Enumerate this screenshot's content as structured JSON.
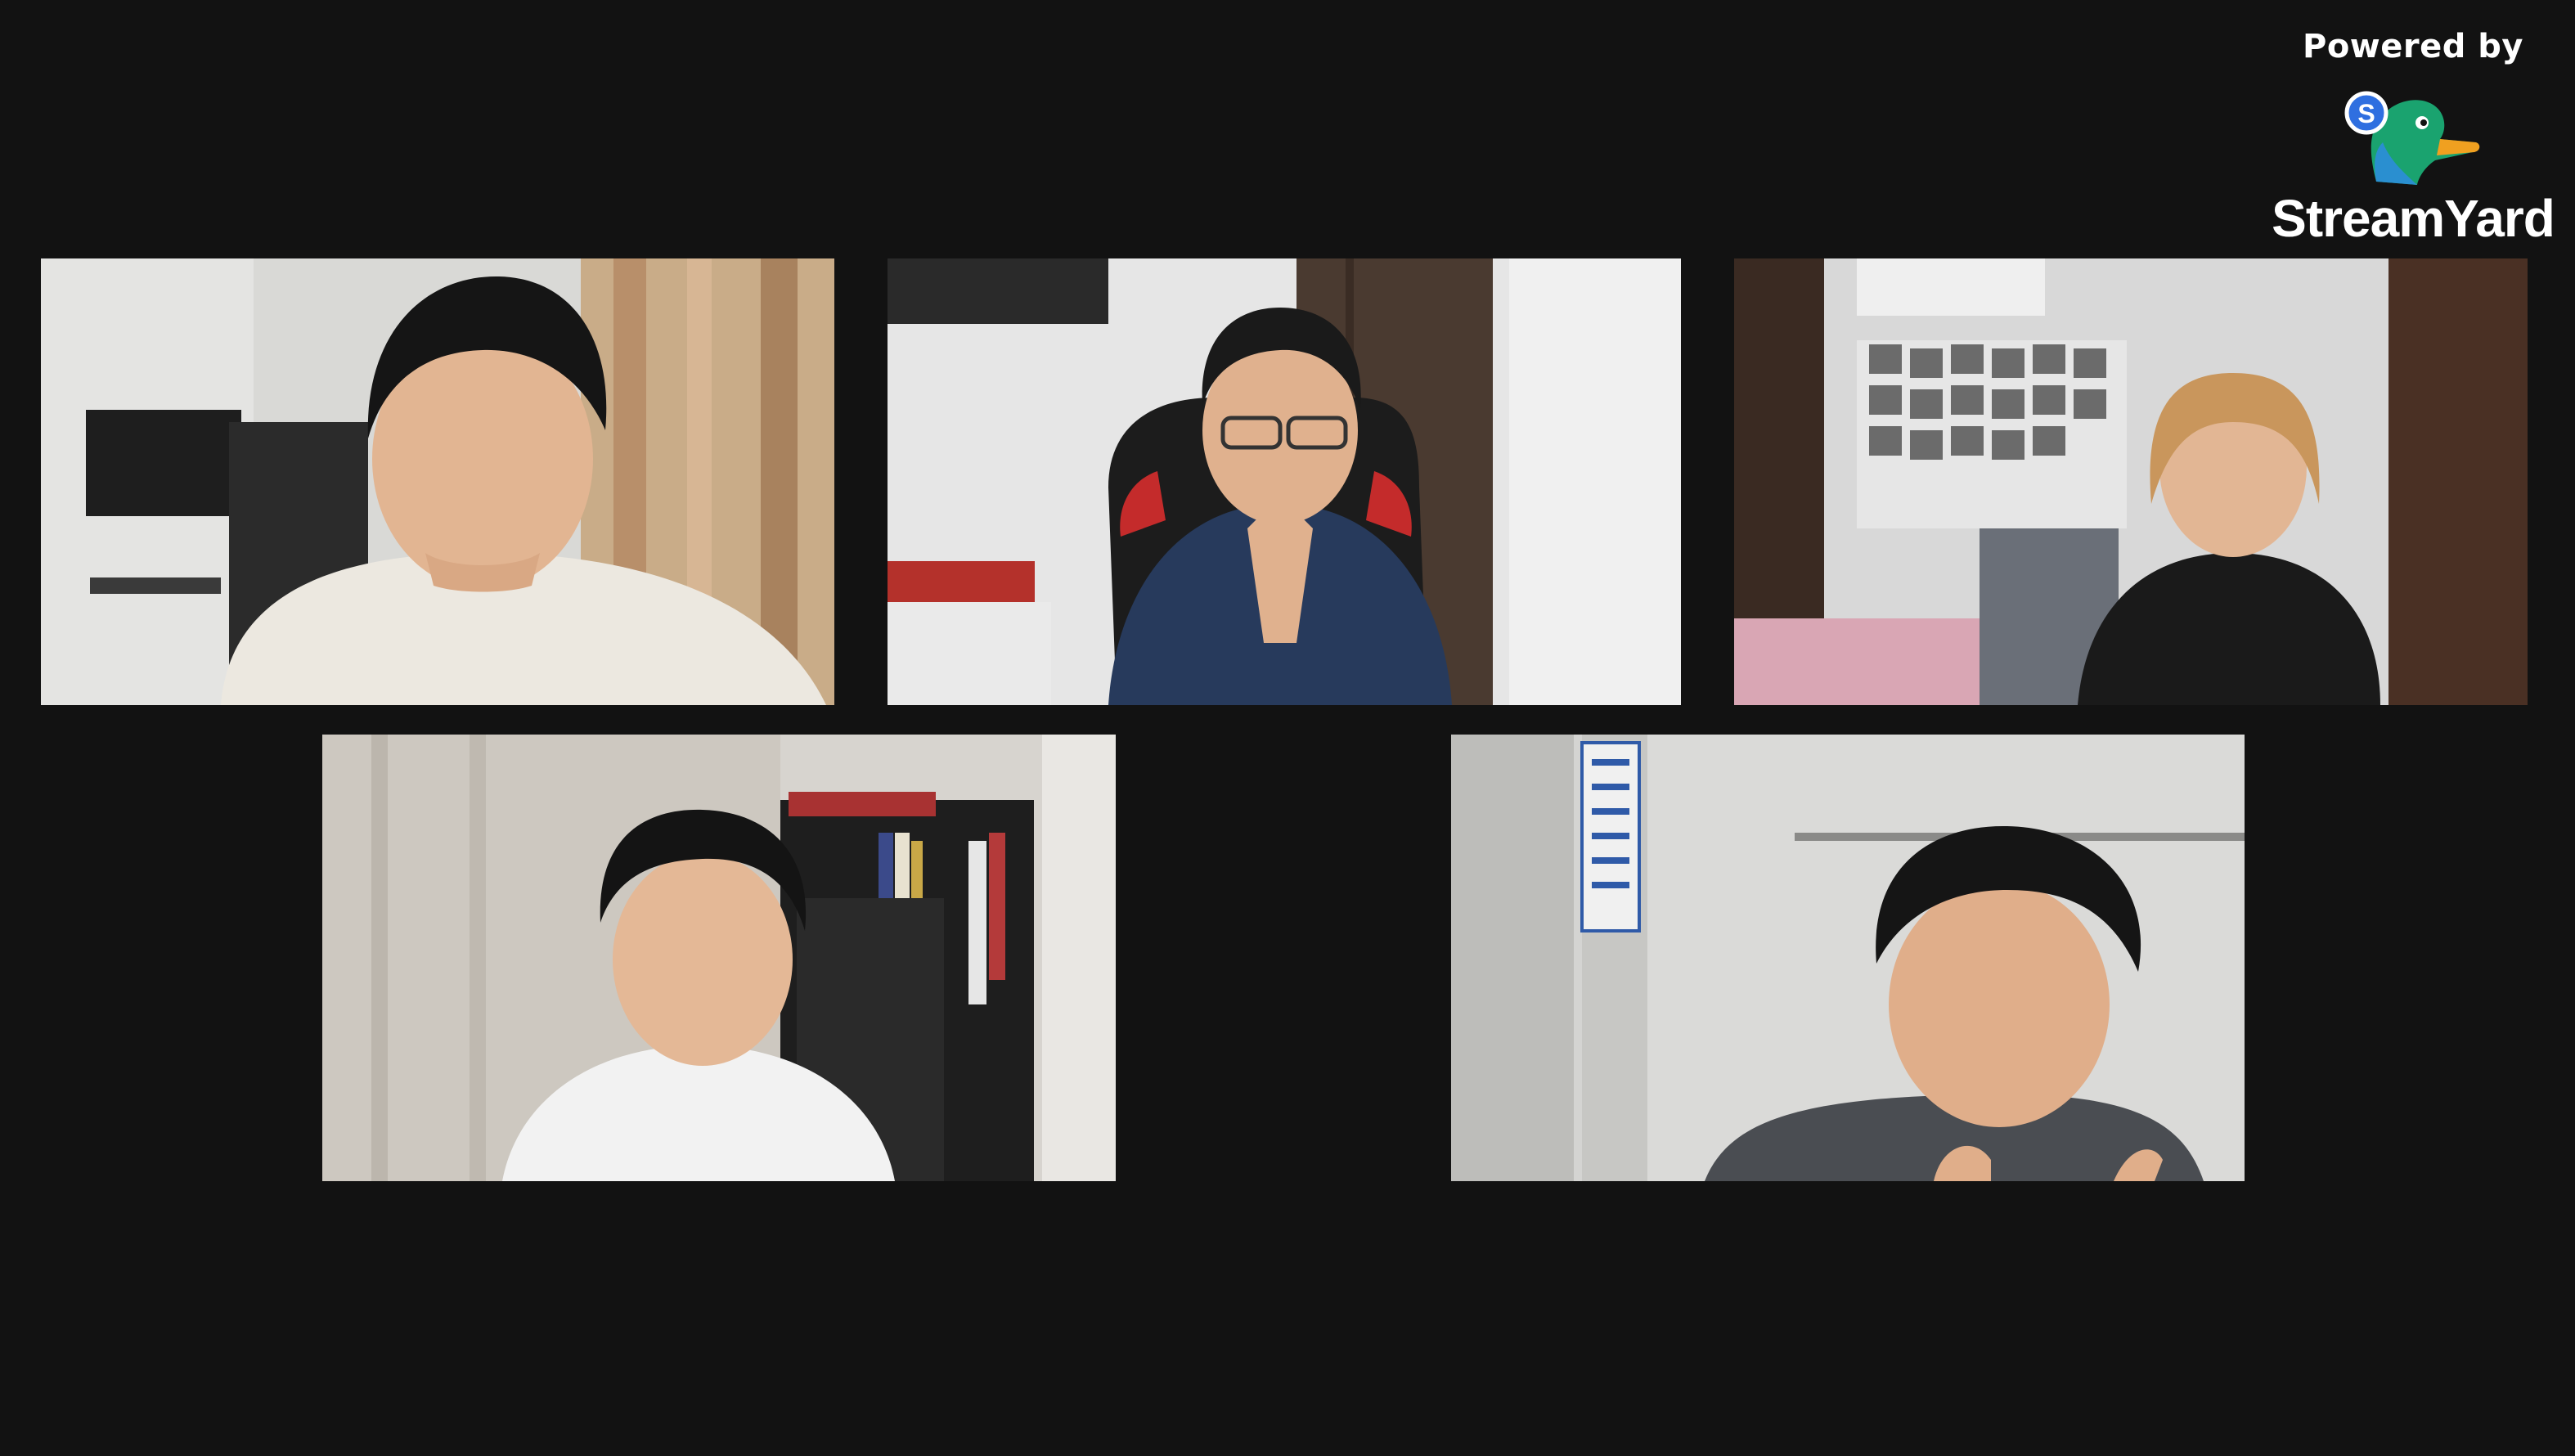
{
  "branding": {
    "powered_by": "Powered by",
    "brand_name": "StreamYard",
    "logo_icon": "streamyard-duck-logo-icon",
    "logo_badge": "S"
  },
  "colors": {
    "background": "#121212",
    "brand_blue": "#2f6fe0",
    "brand_green": "#1aa36f",
    "brand_orange": "#f0a020"
  },
  "participants": [
    {
      "id": "participant-1",
      "shirt": "#ece8e0",
      "wall": "#d9d9d6"
    },
    {
      "id": "participant-2",
      "shirt": "#273a5c",
      "wall": "#e6e6e6"
    },
    {
      "id": "participant-3",
      "shirt": "#1a1a1a",
      "wall": "#d8d8d8"
    },
    {
      "id": "participant-4",
      "shirt": "#f2f2f2",
      "wall": "#d7d4cf"
    },
    {
      "id": "participant-5",
      "shirt": "#4a4d52",
      "wall": "#d4d4d2"
    }
  ]
}
